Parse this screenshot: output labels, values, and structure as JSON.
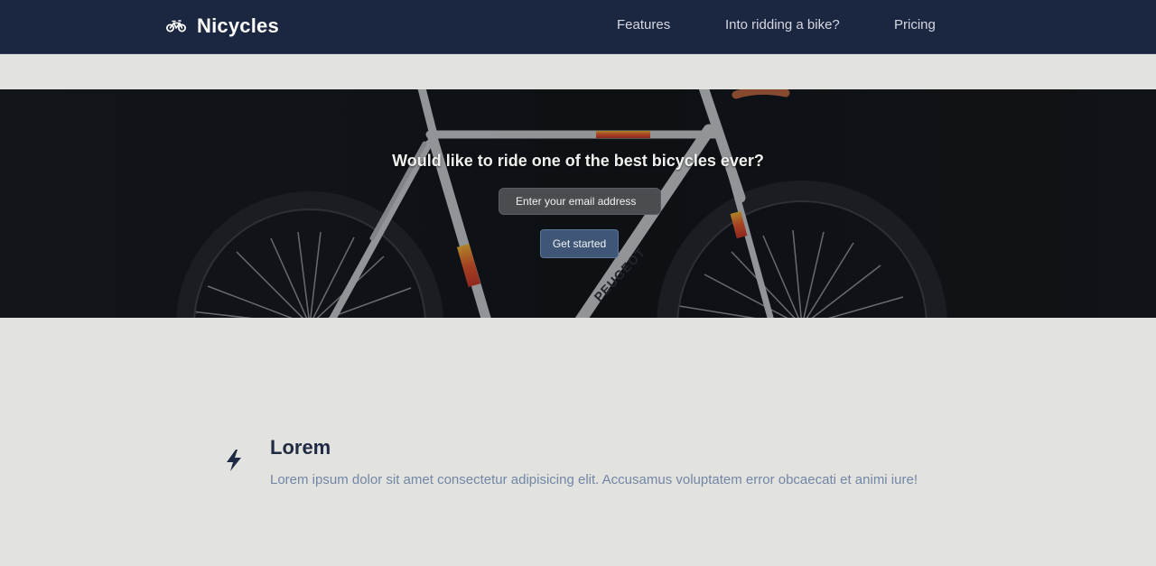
{
  "header": {
    "brand": {
      "icon": "bicycle-icon",
      "name": "Nicycles"
    },
    "nav": [
      {
        "label": "Features"
      },
      {
        "label": "Into ridding a bike?"
      },
      {
        "label": "Pricing"
      }
    ]
  },
  "hero": {
    "title": "Would like to ride one of the best bicycles ever?",
    "email_placeholder": "Enter your email address",
    "button_label": "Get started",
    "frame_lettering": "PEUGEOT"
  },
  "features": [
    {
      "icon": "lightning-bolt-icon",
      "title": "Lorem",
      "text": "Lorem ipsum dolor sit amet consectetur adipisicing elit. Accusamus voluptatem error obcaecati et animi iure!"
    }
  ],
  "colors": {
    "navbar_bg": "#1b2640",
    "page_bg": "#e2e2de",
    "hero_bg": "#111418",
    "button_bg": "#3f5676",
    "feature_title": "#1f2a44",
    "feature_text": "#7286a6"
  }
}
